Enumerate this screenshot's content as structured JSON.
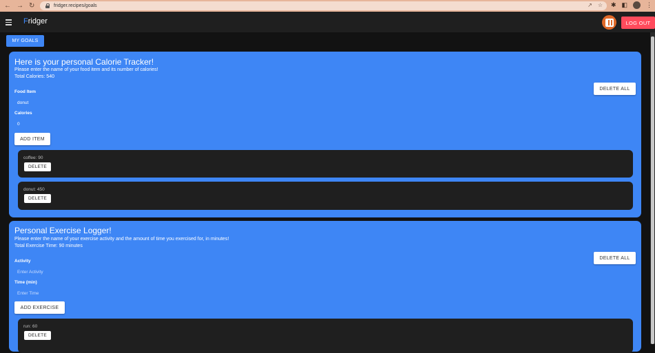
{
  "browser": {
    "url": "fridger.recipes/goals"
  },
  "appbar": {
    "brand_first": "F",
    "brand_rest": "ridger",
    "logout_label": "LOG OUT"
  },
  "goals_button": "MY GOALS",
  "calorie": {
    "title": "Here is your personal Calorie Tracker!",
    "instructions": "Please enter the name of your food item and its number of calories!",
    "total": "Total Calories: 540",
    "food_label": "Food Item",
    "food_value": "donut",
    "calories_label": "Calories",
    "calories_value": "0",
    "add_label": "ADD ITEM",
    "delete_all_label": "DELETE ALL",
    "items": [
      {
        "text": "coffee: 90",
        "delete": "DELETE"
      },
      {
        "text": "donut: 450",
        "delete": "DELETE"
      }
    ]
  },
  "exercise": {
    "title": "Personal Exercise Logger!",
    "instructions": "Please enter the name of your exercise activity and the amount of time you exercised for, in minutes!",
    "total": "Total Exercise Time: 90 minutes",
    "activity_label": "Activity",
    "activity_placeholder": "Enter Activity",
    "time_label": "Time (min)",
    "time_placeholder": "Enter Time",
    "add_label": "ADD EXERCISE",
    "delete_all_label": "DELETE ALL",
    "items": [
      {
        "text": "run: 60",
        "delete": "DELETE"
      }
    ]
  },
  "colors": {
    "accent": "#3e86f5",
    "logout": "#ff4b5c",
    "surface": "#1f1f1f"
  }
}
